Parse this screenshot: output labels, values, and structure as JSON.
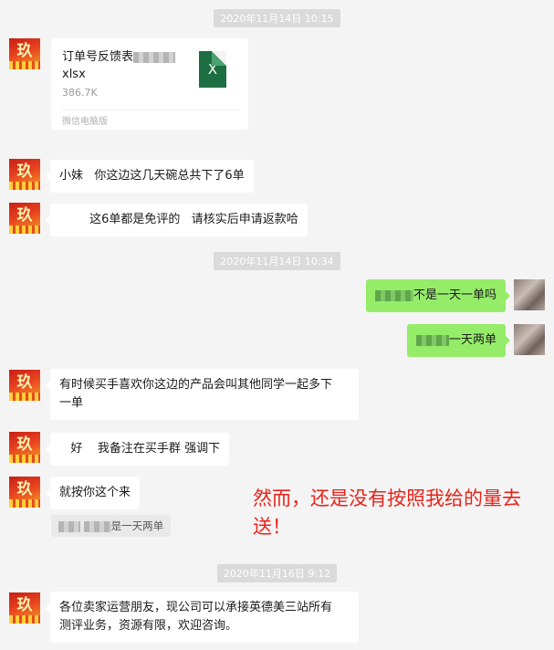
{
  "timestamps": [
    "2020年11月14日 10:15",
    "2020年11月14日 10:34",
    "2020年11月16日 9:12"
  ],
  "file_message": {
    "name_prefix": "订单号反馈表",
    "name_ext": "xlsx",
    "size": "386.7K",
    "source": "微信电脑版",
    "file_icon": "excel-file-icon",
    "icon_letter": "X"
  },
  "messages": {
    "m1": "小妹   你这边这几天碗总共下了6单",
    "m2": "        这6单都是免评的   请核实后申请返款哈",
    "m3": "不是一天一单吗",
    "m4": "一天两单",
    "m5": "有时候买手喜欢你这边的产品会叫其他同学一起多下\n一单",
    "m6": "   好    我备注在买手群 强调下",
    "m7": "就按你这个来",
    "quote_tail": "是一天两单",
    "m8": "各位卖家运营朋友，现公司可以承接英德美三站所有\n测评业务，资源有限，欢迎咨询。"
  },
  "annotation": "然而，还是没有按照我给的量去送！",
  "avatar_glyph": "玖",
  "colors": {
    "background": "#f4f4f4",
    "sent_bubble": "#95ec69",
    "received_bubble": "#ffffff",
    "annotation_red": "#e8231a",
    "excel_green": "#1d6f42"
  }
}
